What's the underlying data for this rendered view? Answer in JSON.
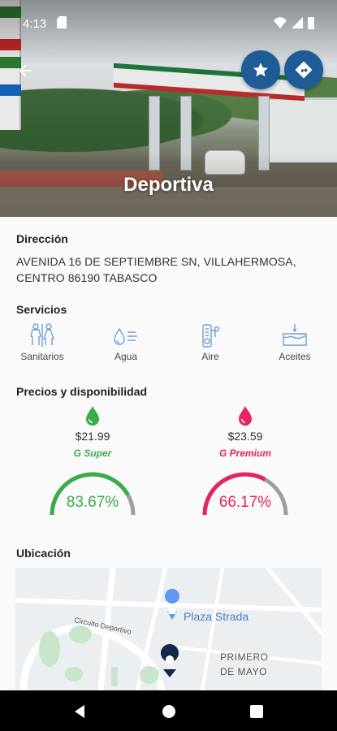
{
  "status_bar": {
    "time": "4:13"
  },
  "hero": {
    "title": "Deportiva"
  },
  "sections": {
    "address_title": "Dirección",
    "address_line1": "AVENIDA 16 DE SEPTIEMBRE SN, VILLAHERMOSA,",
    "address_line2": "CENTRO 86190 TABASCO",
    "services_title": "Servicios",
    "prices_title": "Precios y disponibilidad",
    "location_title": "Ubicación"
  },
  "services": [
    {
      "label": "Sanitarios",
      "icon": "restroom-icon"
    },
    {
      "label": "Agua",
      "icon": "water-icon"
    },
    {
      "label": "Aire",
      "icon": "air-gauge-icon"
    },
    {
      "label": "Aceites",
      "icon": "oil-icon"
    }
  ],
  "fuels": [
    {
      "price": "$21.99",
      "brand": "G Super",
      "availability_label": "83.67%",
      "availability": 0.8367,
      "color": "#3cab4a"
    },
    {
      "price": "$23.59",
      "brand": "G Premium",
      "availability_label": "66.17%",
      "availability": 0.6617,
      "color": "#e6245e"
    }
  ],
  "map": {
    "labels": {
      "plaza": "Plaza Strada",
      "road": "Circuito Deportivo",
      "area_line1": "PRIMERO",
      "area_line2": "DE MAYO"
    }
  },
  "colors": {
    "accent": "#1f5c97",
    "super": "#3cab4a",
    "premium": "#e6245e",
    "service_icons": "#6fa0d8"
  }
}
